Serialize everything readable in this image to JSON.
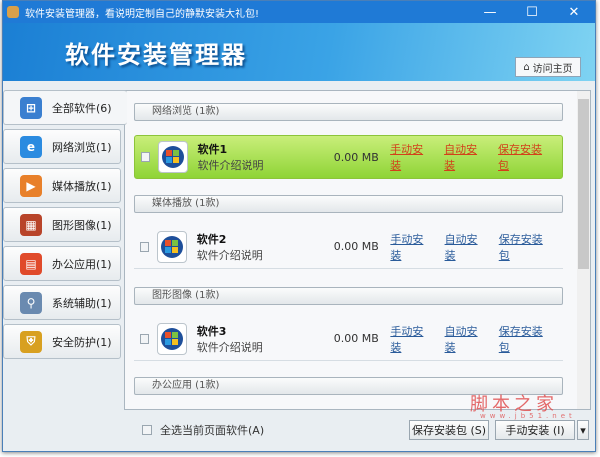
{
  "window": {
    "title": "软件安装管理器，看说明定制自己的静默安装大礼包!",
    "minimize": "—",
    "maximize": "☐",
    "close": "✕"
  },
  "header": {
    "logo": "软件安装管理器",
    "home_button": "访问主页"
  },
  "sidebar": {
    "items": [
      {
        "label": "全部软件(6)",
        "icon": "windows-icon",
        "color": "#3a7fd0"
      },
      {
        "label": "网络浏览(1)",
        "icon": "ie-icon",
        "color": "#2b8be0"
      },
      {
        "label": "媒体播放(1)",
        "icon": "media-player-icon",
        "color": "#e8802a"
      },
      {
        "label": "图形图像(1)",
        "icon": "image-icon",
        "color": "#b8442a"
      },
      {
        "label": "办公应用(1)",
        "icon": "office-icon",
        "color": "#e04a2a"
      },
      {
        "label": "系统辅助(1)",
        "icon": "magnifier-icon",
        "color": "#6a8ab0"
      },
      {
        "label": "安全防护(1)",
        "icon": "shield-icon",
        "color": "#d8a020"
      }
    ]
  },
  "sections": [
    {
      "title": "网络浏览 (1款)",
      "item": {
        "name": "软件1",
        "desc": "软件介绍说明",
        "size": "0.00 MB",
        "highlight": true
      }
    },
    {
      "title": "媒体播放 (1款)",
      "item": {
        "name": "软件2",
        "desc": "软件介绍说明",
        "size": "0.00 MB"
      }
    },
    {
      "title": "图形图像 (1款)",
      "item": {
        "name": "软件3",
        "desc": "软件介绍说明",
        "size": "0.00 MB"
      }
    },
    {
      "title": "办公应用 (1款)"
    }
  ],
  "links": {
    "manual": "手动安装",
    "auto": "自动安装",
    "save": "保存安装包"
  },
  "footer": {
    "select_all": "全选当前页面软件(A)",
    "save_pkg": "保存安装包 (S)",
    "manual_install": "手动安装 (I)",
    "dropdown": "▾"
  },
  "watermark": {
    "text": "脚本之家",
    "url": "www.jb51.net"
  }
}
